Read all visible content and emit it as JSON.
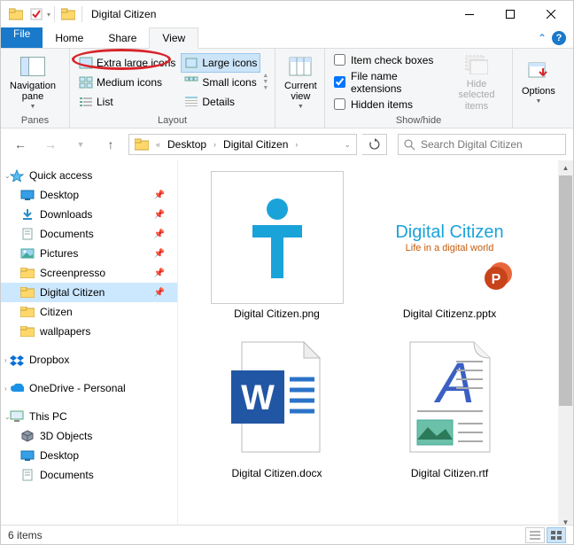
{
  "window": {
    "title": "Digital Citizen"
  },
  "tabs": {
    "file": "File",
    "home": "Home",
    "share": "Share",
    "view": "View"
  },
  "ribbon": {
    "panes": {
      "nav": "Navigation\npane",
      "label": "Panes"
    },
    "layout": {
      "extra_large": "Extra large icons",
      "large": "Large icons",
      "medium": "Medium icons",
      "small": "Small icons",
      "list": "List",
      "details": "Details",
      "label": "Layout"
    },
    "current_view": {
      "btn": "Current\nview",
      "label": ""
    },
    "showhide": {
      "item_check": "Item check boxes",
      "ext": "File name extensions",
      "hidden": "Hidden items",
      "hide_selected": "Hide selected\nitems",
      "label": "Show/hide"
    },
    "options": "Options"
  },
  "addressbar": {
    "crumb1": "Desktop",
    "crumb2": "Digital Citizen",
    "search_placeholder": "Search Digital Citizen"
  },
  "nav": {
    "quick": "Quick access",
    "desktop": "Desktop",
    "downloads": "Downloads",
    "documents": "Documents",
    "pictures": "Pictures",
    "screenpresso": "Screenpresso",
    "digital_citizen": "Digital Citizen",
    "citizen": "Citizen",
    "wallpapers": "wallpapers",
    "dropbox": "Dropbox",
    "onedrive": "OneDrive - Personal",
    "thispc": "This PC",
    "objects3d": "3D Objects",
    "desktop2": "Desktop",
    "documents2": "Documents"
  },
  "files": {
    "f1": "Digital Citizen.png",
    "f2": "Digital Citizenz.pptx",
    "f3": "Digital Citizen.docx",
    "f4": "Digital Citizen.rtf",
    "dc_title": "Digital Citizen",
    "dc_sub": "Life in a digital world"
  },
  "status": {
    "count": "6 items"
  },
  "colors": {
    "accent": "#1979ca",
    "highlight": "#d8232a"
  }
}
